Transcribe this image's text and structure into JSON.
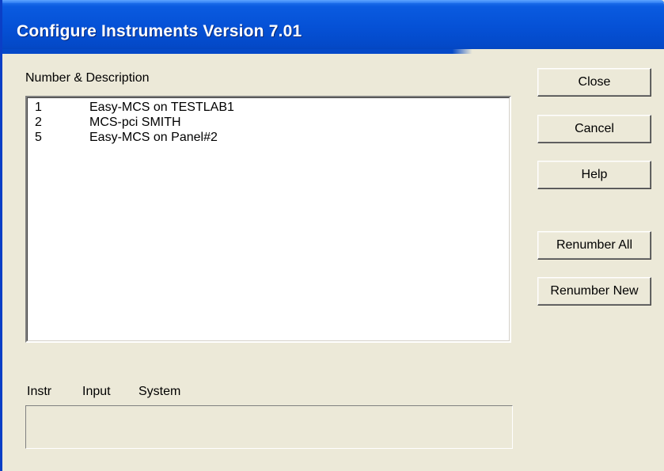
{
  "window": {
    "title": "Configure Instruments Version 7.01"
  },
  "list": {
    "header": "Number & Description",
    "items": [
      {
        "number": "1",
        "description": "Easy-MCS on TESTLAB1"
      },
      {
        "number": "2",
        "description": "MCS-pci SMITH"
      },
      {
        "number": "5",
        "description": "Easy-MCS on Panel#2"
      }
    ]
  },
  "buttons": {
    "close": "Close",
    "cancel": "Cancel",
    "help": "Help",
    "renumber_all": "Renumber All",
    "renumber_new": "Renumber New"
  },
  "details": {
    "col_instr": "Instr",
    "col_input": "Input",
    "col_system": "System",
    "value": ""
  },
  "colors": {
    "titlebar": "#0551d6",
    "dialog_bg": "#ece9d8"
  }
}
